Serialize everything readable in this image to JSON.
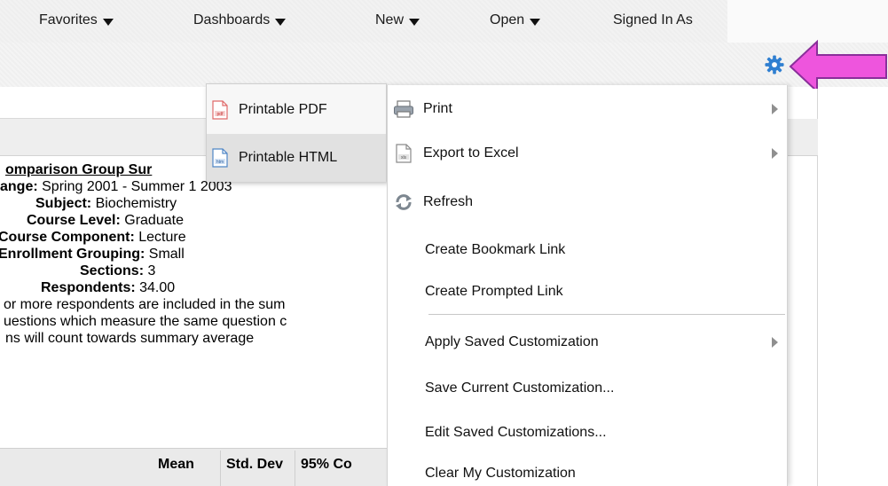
{
  "nav": {
    "favorites": "Favorites",
    "dashboards": "Dashboards",
    "new": "New",
    "open": "Open",
    "signed_in": "Signed In As"
  },
  "report": {
    "title": "omparison Group Sur",
    "lines": [
      {
        "label": "ange:",
        "value": " Spring 2001 - Summer 1 2003"
      },
      {
        "label": "Subject:",
        "value": " Biochemistry"
      },
      {
        "label": "Course Level:",
        "value": " Graduate"
      },
      {
        "label": "Course Component:",
        "value": " Lecture",
        "prefix": ""
      },
      {
        "label": "Enrollment Grouping:",
        "value": " Small"
      },
      {
        "label": "Sections:",
        "value": " 3"
      },
      {
        "label": "Respondents:",
        "value": " 34.00"
      }
    ],
    "notes": [
      "or more respondents are included in the sum",
      "uestions which measure the same question c",
      "ns will count towards summary average"
    ],
    "columns": [
      "Mean",
      "Std. Dev",
      "95% Co"
    ]
  },
  "submenu": {
    "items": [
      {
        "label": "Printable PDF",
        "icon": "pdf-file-icon"
      },
      {
        "label": "Printable HTML",
        "icon": "html-file-icon"
      }
    ]
  },
  "menu": {
    "items": [
      {
        "label": "Print",
        "icon": "printer-icon",
        "has_submenu": true
      },
      {
        "label": "Export to Excel",
        "icon": "excel-file-icon",
        "has_submenu": true
      },
      {
        "label": "Refresh",
        "icon": "refresh-icon",
        "has_submenu": false
      },
      {
        "label": "Create Bookmark Link",
        "icon": "",
        "has_submenu": false
      },
      {
        "label": "Create Prompted Link",
        "icon": "",
        "has_submenu": false
      },
      {
        "label": "Apply Saved Customization",
        "icon": "",
        "has_submenu": true
      },
      {
        "label": "Save Current Customization...",
        "icon": "",
        "has_submenu": false
      },
      {
        "label": "Edit Saved Customizations...",
        "icon": "",
        "has_submenu": false
      },
      {
        "label": "Clear My Customization",
        "icon": "",
        "has_submenu": false
      }
    ]
  },
  "colors": {
    "gear": "#2f7fd1",
    "annotation_arrow": "#ee55dd",
    "annotation_arrow_border": "#8a2f9a"
  }
}
